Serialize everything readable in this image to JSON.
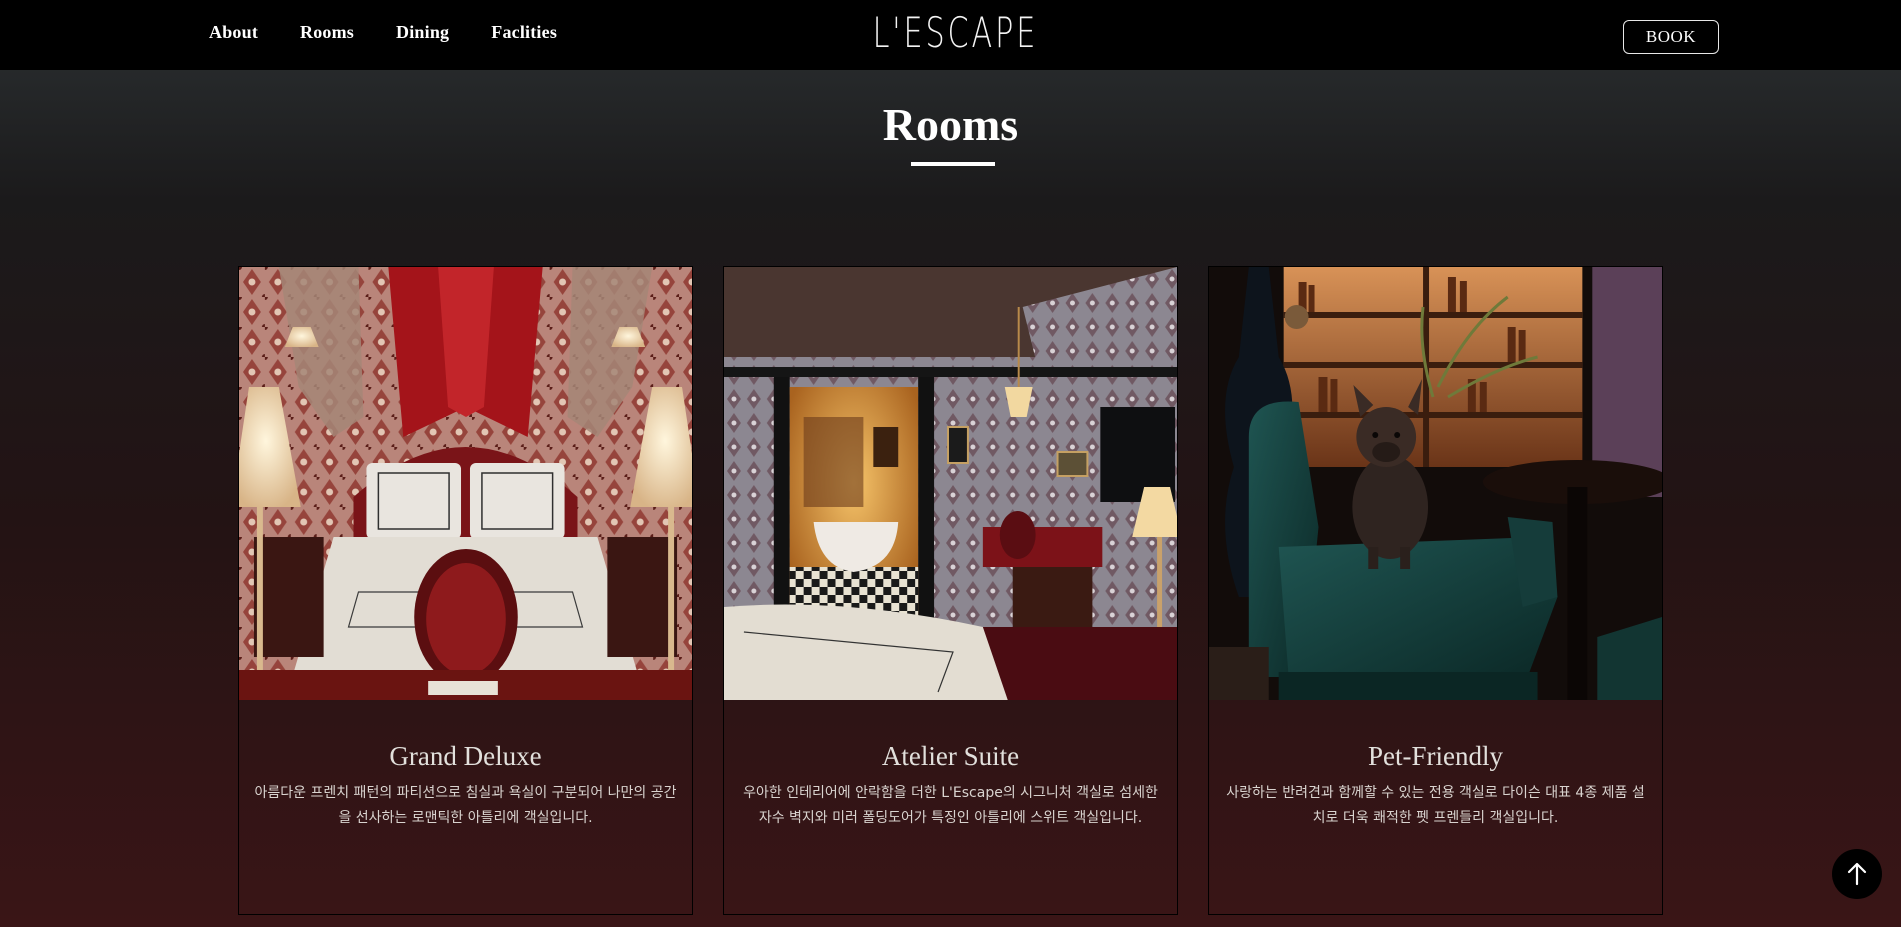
{
  "header": {
    "nav": [
      "About",
      "Rooms",
      "Dining",
      "Faclities"
    ],
    "logo": "L'ESCAPE",
    "book_label": "BOOK"
  },
  "section": {
    "title": "Rooms"
  },
  "rooms": [
    {
      "name": "Grand Deluxe",
      "description": "아름다운 프렌치 패턴의 파티션으로 침실과 욕실이 구분되어 나만의 공간을 선사하는 로맨틱한 아틀리에 객실입니다.",
      "photo": "red canopy bed room with patterned wallpaper and lamps"
    },
    {
      "name": "Atelier Suite",
      "description": "우아한 인테리어에 안락함을 더한 L'Escape의 시그니처 객실로 섬세한 자수 벽지와 미러 폴딩도어가 특징인 아틀리에 스위트 객실입니다.",
      "photo": "suite with bathtub behind mirrored folding doors"
    },
    {
      "name": "Pet-Friendly",
      "description": "사랑하는 반려견과 함께할 수 있는 전용 객실로 다이슨 대표 4종 제품 설치로 더욱 쾌적한 펫 프렌들리 객실입니다.",
      "photo": "french bulldog sitting on green velvet armchair in library"
    }
  ],
  "icons": {
    "scroll_top": "arrow-up-icon"
  },
  "colors": {
    "header_bg": "#000000",
    "page_gradient_top": "#2c3133",
    "page_gradient_bottom": "#3a1516",
    "text": "#ffffff"
  }
}
